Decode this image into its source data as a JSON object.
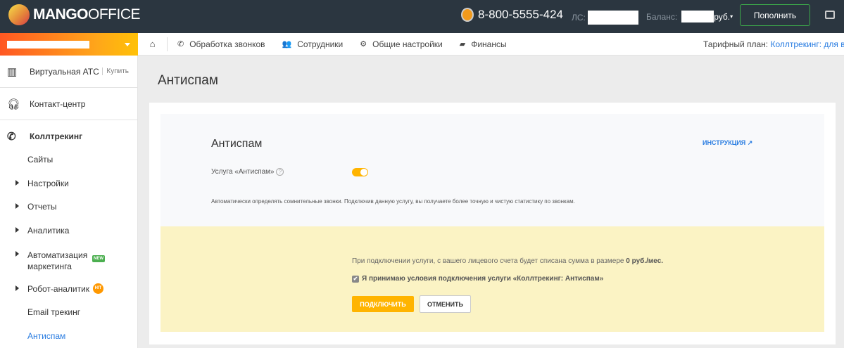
{
  "header": {
    "logo_bold": "MANGO",
    "logo_light": "OFFICE",
    "phone": "8-800-5555-424",
    "account_label": "ЛС:",
    "balance_label": "Баланс:",
    "balance_currency": "руб.",
    "topup_button": "Пополнить"
  },
  "nav": {
    "items": [
      {
        "label": "Обработка звонков",
        "icon": "phone-icon"
      },
      {
        "label": "Сотрудники",
        "icon": "users-icon"
      },
      {
        "label": "Общие настройки",
        "icon": "gear-icon"
      },
      {
        "label": "Финансы",
        "icon": "wallet-icon"
      }
    ],
    "tariff_label": "Тарифный план:",
    "tariff_value": "Коллтрекинг: для вну"
  },
  "sidebar": {
    "vats": "Виртуальная АТС",
    "buy": "Купить",
    "contact": "Контакт-центр",
    "calltracking": "Коллтрекинг",
    "items": [
      "Сайты",
      "Настройки",
      "Отчеты",
      "Аналитика",
      "Автоматизация маркетинга",
      "Робот-аналитик",
      "Email трекинг",
      "Антиспам"
    ],
    "badge_new": "NEW",
    "badge_hit": "HIT"
  },
  "page": {
    "title": "Антиспам",
    "card_title": "Антиспам",
    "instruction": "ИНСТРУКЦИЯ",
    "service_label": "Услуга «Антиспам»",
    "service_enabled": true,
    "description": "Автоматически определять сомнительные звонки. Подключив данную услугу, вы получаете более точную и чистую статистику по звонкам.",
    "charge_text": "При подключении услуги, с вашего лицевого счета будет списана сумма в размере",
    "charge_amount": "0 руб./мес.",
    "agree_text": "Я принимаю условия подключения услуги «Коллтрекинг: Антиспам»",
    "agree_checked": true,
    "connect_button": "ПОДКЛЮЧИТЬ",
    "cancel_button": "ОТМЕНИТЬ"
  },
  "colors": {
    "accent": "#ffb400",
    "link": "#2a7de1",
    "topbar": "#2b3640"
  }
}
